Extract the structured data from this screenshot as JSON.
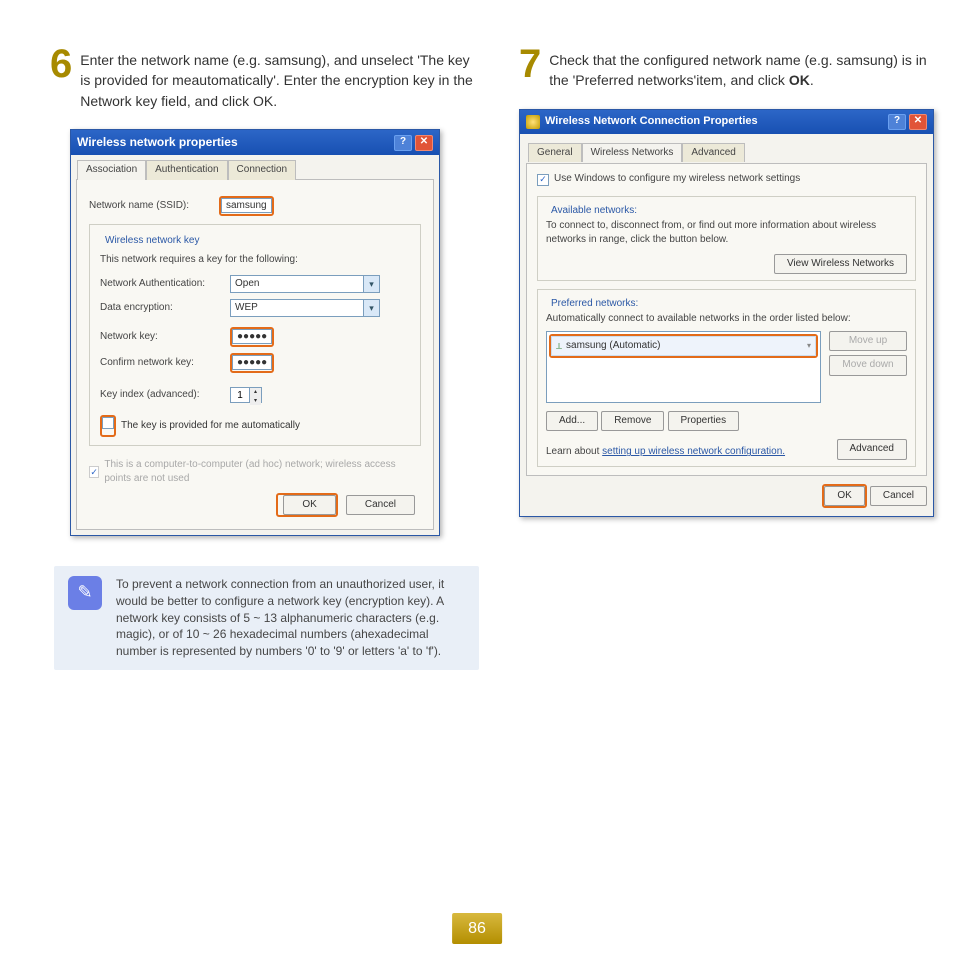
{
  "steps": {
    "step6": {
      "num": "6",
      "text_part1": "Enter the network name (e.g. samsung), and unselect 'The key is provided for meautomatically'. Enter the encryption key in the Network key field, and click OK."
    },
    "step7": {
      "num": "7",
      "text_part1": "Check that the configured network name (e.g. samsung) is in the 'Preferred networks'item, and click ",
      "ok": "OK",
      "dot": "."
    }
  },
  "dialog1": {
    "title": "Wireless network properties",
    "tabs": {
      "assoc": "Association",
      "auth": "Authentication",
      "conn": "Connection"
    },
    "ssid_label": "Network name (SSID):",
    "ssid_value": "samsung",
    "fieldset_legend": "Wireless network key",
    "key_msg": "This network requires a key for the following:",
    "auth_label": "Network Authentication:",
    "auth_value": "Open",
    "enc_label": "Data encryption:",
    "enc_value": "WEP",
    "netkey_label": "Network key:",
    "netkey_value": "●●●●●",
    "confirm_label": "Confirm network key:",
    "confirm_value": "●●●●●",
    "index_label": "Key index (advanced):",
    "index_value": "1",
    "auto_key": "The key is provided for me automatically",
    "adhoc": "This is a computer-to-computer (ad hoc) network; wireless access points are not used",
    "ok": "OK",
    "cancel": "Cancel"
  },
  "dialog2": {
    "title": "Wireless Network Connection Properties",
    "tabs": {
      "gen": "General",
      "wn": "Wireless Networks",
      "adv": "Advanced"
    },
    "use_windows": "Use Windows to configure my wireless network settings",
    "avail_legend": "Available networks:",
    "avail_text": "To connect to, disconnect from, or find out more information about wireless networks in range, click the button below.",
    "view_btn": "View Wireless Networks",
    "pref_legend": "Preferred networks:",
    "pref_text": "Automatically connect to available networks in the order listed below:",
    "item": "samsung (Automatic)",
    "moveup": "Move up",
    "movedown": "Move down",
    "add": "Add...",
    "remove": "Remove",
    "props": "Properties",
    "learn": "Learn about ",
    "learn_link": "setting up wireless network configuration.",
    "advanced": "Advanced",
    "ok": "OK",
    "cancel": "Cancel"
  },
  "note": {
    "text": "To prevent a network connection from an unauthorized user, it would be better to configure a network key (encryption key). A network key consists of 5 ~ 13 alphanumeric characters (e.g. magic), or of 10 ~ 26 hexadecimal numbers (ahexadecimal number is represented by numbers '0' to '9' or letters 'a' to 'f')."
  },
  "page_number": "86"
}
